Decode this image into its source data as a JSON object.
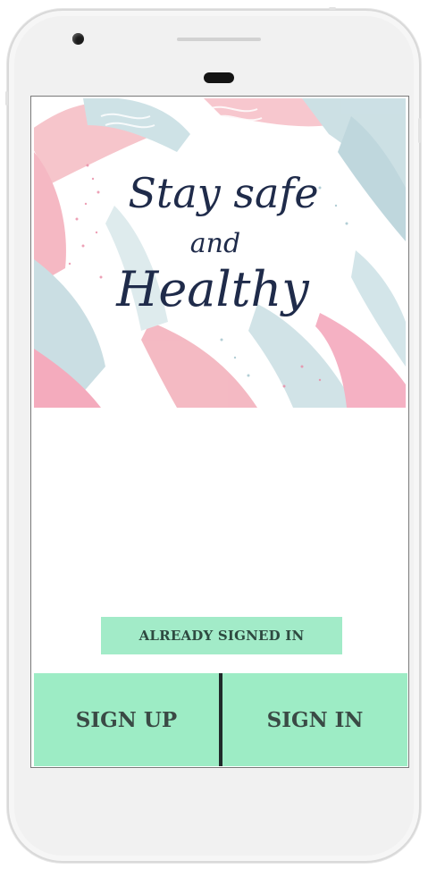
{
  "hero": {
    "line1": "Stay safe",
    "line2": "and",
    "line3": "Healthy"
  },
  "actions": {
    "already_signed_in": "ALREADY SIGNED IN",
    "sign_up": "SIGN UP",
    "sign_in": "SIGN IN"
  },
  "colors": {
    "accent": "#9decc5",
    "text_dark": "#1f2b4a",
    "pink": "#f6b7c4",
    "blue_gray": "#c7dde2"
  },
  "icons": {
    "camera": "front-camera-icon",
    "earpiece": "earpiece-icon"
  }
}
